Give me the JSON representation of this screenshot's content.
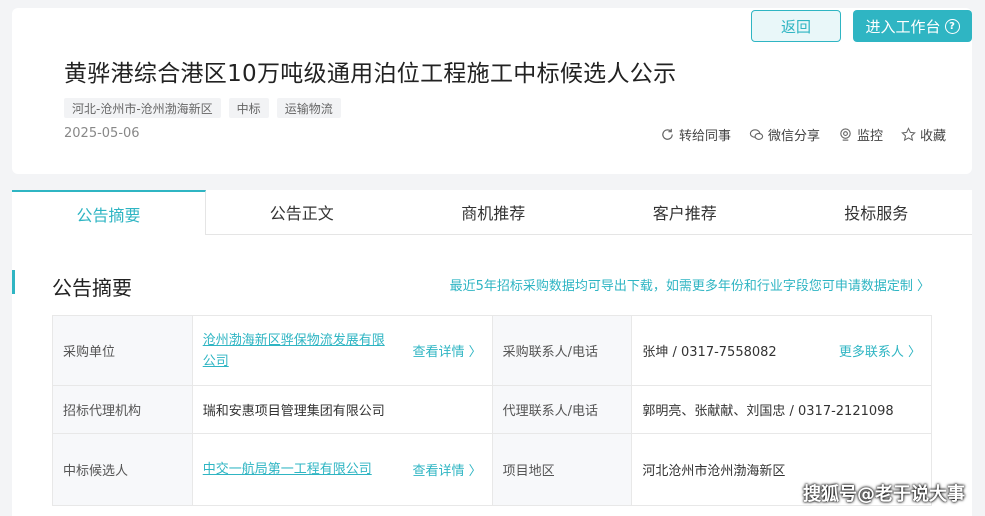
{
  "header": {
    "back_label": "返回",
    "workbench_label": "进入工作台",
    "help_icon": "question-circle-icon",
    "title": "黄骅港综合港区10万吨级通用泊位工程施工中标候选人公示",
    "tags": [
      "河北-沧州市-沧州渤海新区",
      "中标",
      "运输物流"
    ],
    "date": "2025-05-06",
    "actions": [
      {
        "label": "转给同事",
        "icon": "forward-icon"
      },
      {
        "label": "微信分享",
        "icon": "wechat-icon"
      },
      {
        "label": "监控",
        "icon": "monitor-icon"
      },
      {
        "label": "收藏",
        "icon": "star-icon"
      }
    ]
  },
  "tabs": [
    "公告摘要",
    "公告正文",
    "商机推荐",
    "客户推荐",
    "投标服务"
  ],
  "summary": {
    "title": "公告摘要",
    "export_link": "最近5年招标采购数据均可导出下载，如需更多年份和行业字段您可申请数据定制 〉",
    "rows": [
      {
        "l1": "采购单位",
        "v1": "沧州渤海新区骅保物流发展有限公司",
        "v1_more": "查看详情 〉",
        "l2": "采购联系人/电话",
        "v2": "张坤 / 0317-7558082",
        "v2_more": "更多联系人 〉"
      },
      {
        "l1": "招标代理机构",
        "v1": "瑞和安惠项目管理集团有限公司",
        "l2": "代理联系人/电话",
        "v2": "郭明亮、张献献、刘国忠 / 0317-2121098"
      },
      {
        "l1": "中标候选人",
        "v1": "中交一航局第一工程有限公司",
        "v1_more": "查看详情 〉",
        "l2": "项目地区",
        "v2": "河北沧州市沧州渤海新区"
      }
    ]
  },
  "watermark": "搜狐号@老于说大事",
  "colors": {
    "accent": "#2fb5c3",
    "bg": "#f3f4f6"
  }
}
